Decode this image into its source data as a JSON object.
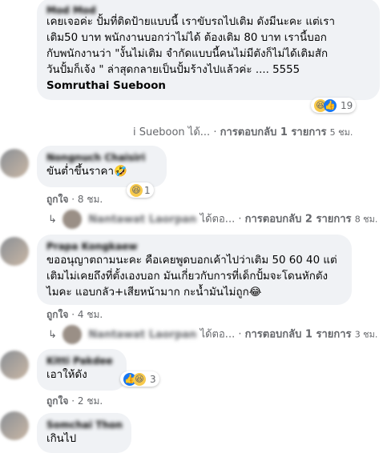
{
  "comments": [
    {
      "name": "Mod Mod",
      "text": "เคยเจอค่ะ ปั้มที่ติดป้ายแบบนี้ เราขับรถไปเติม ดังมีนะคะ แต่เรา\nเติม50 บาท พนักงานบอกว่าไม่ได้ ต้องเติม 80 บาท เรานี้บอก\nกับพนักงานว่า \"งั้นไม่เติม จำกัดแบบนี้คนไม่มีตังก็ไม่ได้เติมสัก\nวันปั้มก็เจ้ง \" ล่าสุดกลายเป็นปั้มร้างไปแล้วค่ะ .... 5555",
      "tag": "Somruthai Sueboon",
      "reaction_count": "19",
      "reaction_icons": [
        "haha-icon",
        "like-icon"
      ]
    },
    {
      "name": "Nongnuch Chaisiri",
      "text": "ขันต่ำขึ้นราคา🤣",
      "reaction_count": "1",
      "reaction_icons": [
        "haha-icon"
      ],
      "meta": {
        "like": "ถูกใจ",
        "time": "8 ชม."
      }
    },
    {
      "name": "Prapa Kongkaew",
      "text": "ขออนุญาตถามนะคะ คือเคยพูดบอกเค้าไปว่าเติม 50 60 40 แต่\nเติมไม่เคยถึงที่ตั้งเองบอก มันเกี่ยวกับการที่เด็กปั้มจะโดนหักตัง\nไมคะ แอบกลัว+เสียหน้ามาก กะน้ำมันไม่ถูก😂",
      "meta": {
        "like": "ถูกใจ",
        "time": "4 ชม."
      }
    },
    {
      "name": "Kitti Pakdee",
      "text": "เอาให้ดัง",
      "reaction_count": "3",
      "reaction_icons": [
        "like-icon",
        "haha-icon"
      ],
      "meta": {
        "like": "ถูกใจ",
        "time": "2 ชม."
      }
    },
    {
      "name": "Somchai Thongsuk",
      "text": "เกินไป"
    }
  ],
  "reply_rows": [
    {
      "name": "i Sueboon",
      "label": "ได้...",
      "replies": "การตอบกลับ 1 รายการ",
      "time": "5 ชม."
    },
    {
      "name": "Nantawat Laorpan",
      "label": "ได้ตอ...",
      "replies": "การตอบกลับ 2 รายการ",
      "time": "8 ชม."
    },
    {
      "name": "Nantawat Laorpan",
      "label": "ได้ตอ...",
      "replies": "การตอบกลับ 1 รายการ",
      "time": "3 ชม."
    }
  ],
  "dot": "·"
}
